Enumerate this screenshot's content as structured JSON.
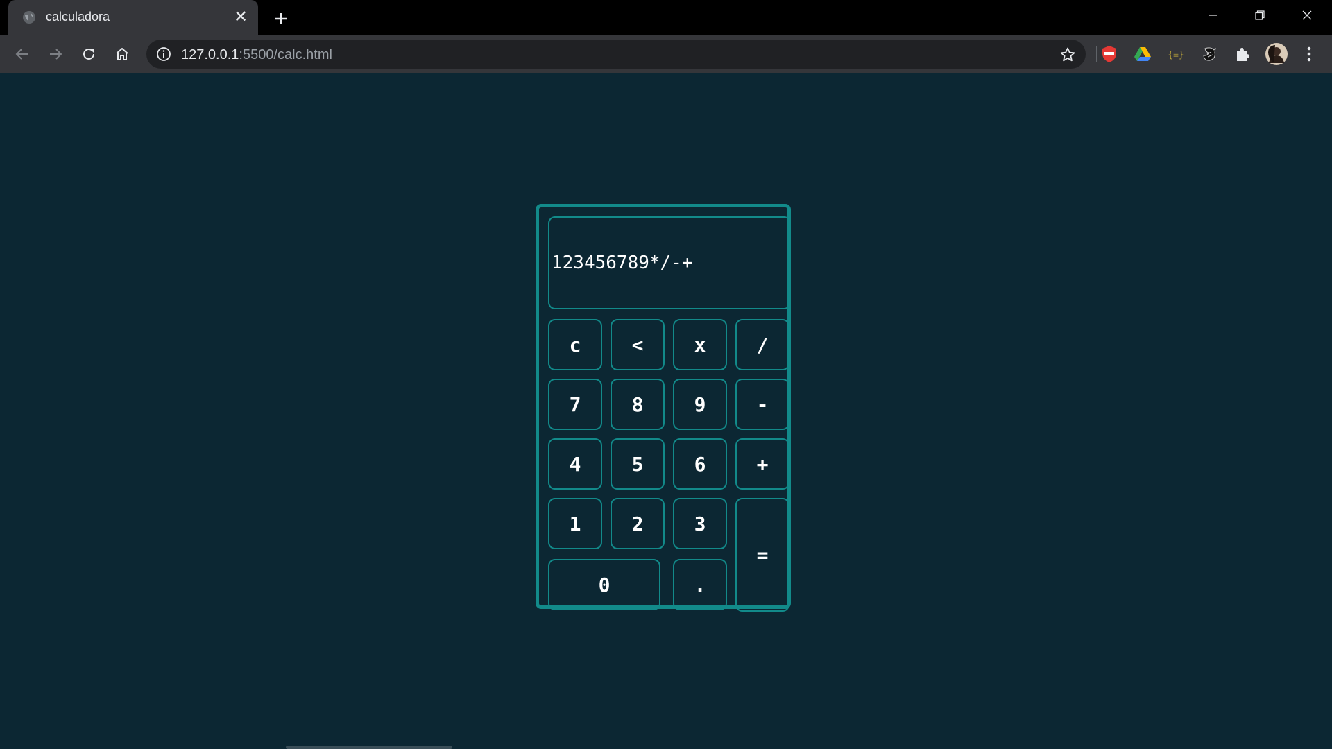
{
  "browser": {
    "tab_title": "calculadora",
    "tab_close": "✕",
    "new_tab": "+",
    "url_host": "127.0.0.1",
    "url_rest": ":5500/calc.html"
  },
  "calculator": {
    "display": "123456789*/-+",
    "keys": {
      "clear": "c",
      "backspace": "<",
      "multiply": "x",
      "divide": "/",
      "seven": "7",
      "eight": "8",
      "nine": "9",
      "minus": "-",
      "four": "4",
      "five": "5",
      "six": "6",
      "plus": "+",
      "one": "1",
      "two": "2",
      "three": "3",
      "equals": "=",
      "zero": "0",
      "dot": "."
    }
  },
  "colors": {
    "page_bg": "#0c2733",
    "accent": "#128a8a",
    "chrome_dark": "#000000",
    "chrome_toolbar": "#35363a"
  },
  "icons": [
    "globe-icon",
    "close-icon",
    "plus-icon",
    "minimize-icon",
    "restore-icon",
    "window-close-icon",
    "back-arrow-icon",
    "forward-arrow-icon",
    "reload-icon",
    "home-icon",
    "info-icon",
    "star-icon",
    "adblock-icon",
    "google-drive-icon",
    "json-viewer-icon",
    "tiger-icon",
    "puzzle-icon",
    "avatar",
    "kebab-menu-icon"
  ]
}
